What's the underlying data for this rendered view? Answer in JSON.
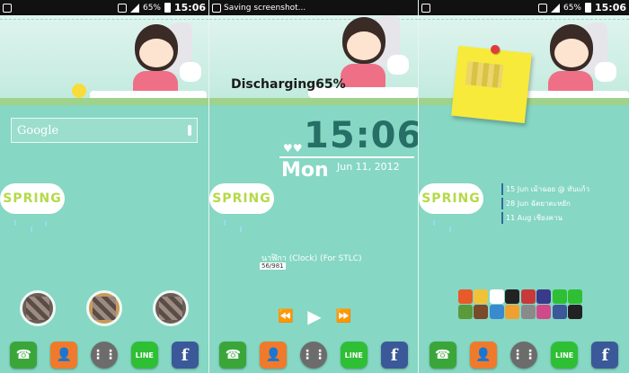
{
  "status": {
    "time": "15:06",
    "battery": "65%",
    "notification": "Saving screenshot..."
  },
  "home_left": {
    "search_label": "Google",
    "spring_label": "SPRING"
  },
  "home_middle": {
    "battery_text": "Discharging65%",
    "clock_time": "15:06",
    "clock_day": "Mon",
    "clock_date": "Jun 11, 2012",
    "music_title": "นาฬิกา (Clock) (For STLC)",
    "music_track": "56/981",
    "spring_label": "SPRING"
  },
  "home_right": {
    "spring_label": "SPRING",
    "events": [
      "15 Jun เม้าฉอย @ ทับแก้ว",
      "28 Jun ฉัตยาตะหยัก",
      "11 Aug เชียงคาน"
    ]
  },
  "dock": {
    "line_label": "LINE",
    "fb_label": "f"
  },
  "colors": {
    "background": "#86d7c4",
    "clock_accent": "#266f66",
    "spring_text": "#b5d94a"
  }
}
